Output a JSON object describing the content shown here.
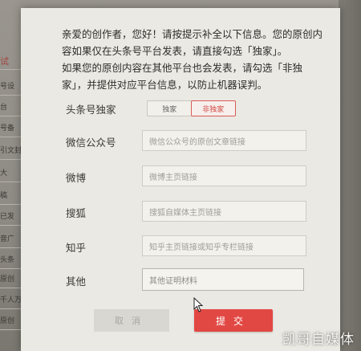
{
  "background": {
    "sidebar_items": [
      "试",
      "号设",
      "台",
      "号备",
      "引文封",
      "大",
      "稿",
      "已发",
      "音广",
      "头条",
      "原创",
      "千人万",
      "原创"
    ]
  },
  "modal": {
    "intro_lines": [
      "亲爱的创作者，您好！请按提示补全以下信息。您的原创内",
      "容如果仅在头条号平台发表，请直接勾选「独家」。",
      "如果您的原创内容在其他平台也会发表，请勾选「非独",
      "家」，并提供对应平台信息，以防止机器误判。"
    ],
    "exclusive": {
      "label": "头条号独家",
      "option_exclusive": "独家",
      "option_non_exclusive": "非独家",
      "selected": "非独家"
    },
    "fields": {
      "wechat": {
        "label": "微信公众号",
        "placeholder": "微信公众号的原创文章链接"
      },
      "weibo": {
        "label": "微博",
        "placeholder": "微博主页链接"
      },
      "sohu": {
        "label": "搜狐",
        "placeholder": "搜狐自媒体主页链接"
      },
      "zhihu": {
        "label": "知乎",
        "placeholder": "知乎主页链接或知乎专栏链接"
      },
      "other": {
        "label": "其他",
        "placeholder": "其他证明材料"
      }
    },
    "buttons": {
      "cancel": "取消",
      "submit": "提交"
    }
  },
  "watermark": "凯哥自媒体",
  "colors": {
    "accent": "#e24843",
    "modal_bg": "#ebe9e3"
  }
}
